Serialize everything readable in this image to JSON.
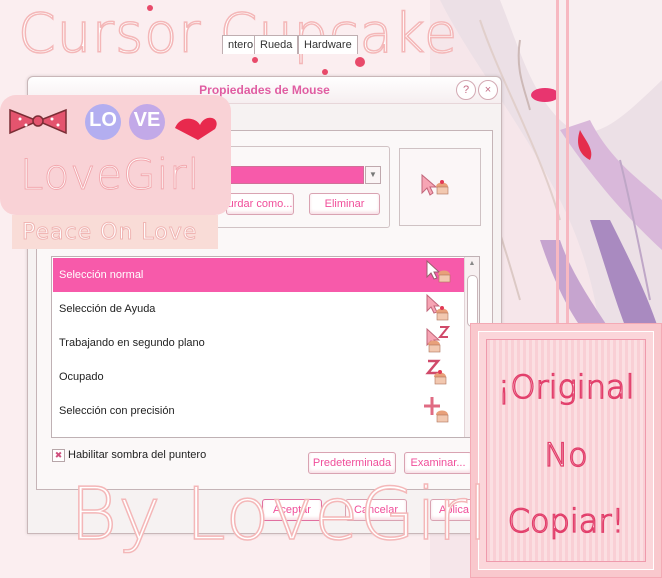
{
  "overlay": {
    "title": "Cursor Cupcake",
    "by": "By LoveGirl"
  },
  "badge": {
    "love_letters": [
      "LO",
      "VE"
    ],
    "name": "LoveGirl",
    "tagline": "Peace On Love"
  },
  "stamp": {
    "lines": [
      "¡Original",
      "No",
      "Copiar!"
    ]
  },
  "window": {
    "title": "Propiedades de Mouse",
    "help_button": "?",
    "close_button": "×",
    "tabs": [
      "ntero",
      "Rueda",
      "Hardware"
    ],
    "buttons": {
      "save_as": "urdar como...",
      "delete": "Eliminar",
      "default": "Predeterminada",
      "browse": "Examinar...",
      "accept": "Aceptar",
      "cancel": "Cancelar",
      "apply": "Aplica"
    },
    "cursor_list": [
      "Selección normal",
      "Selección de Ayuda",
      "Trabajando en segundo plano",
      "Ocupado",
      "Selección con precisión"
    ],
    "selected_index": 0,
    "shadow_checkbox": {
      "label": "Habilitar sombra del puntero",
      "checked": true
    }
  },
  "colors": {
    "accent_pink": "#f75aaa",
    "title_pink": "#e05da2",
    "button_text": "#f04e9a",
    "badge_bg": "#f9d2d6"
  }
}
